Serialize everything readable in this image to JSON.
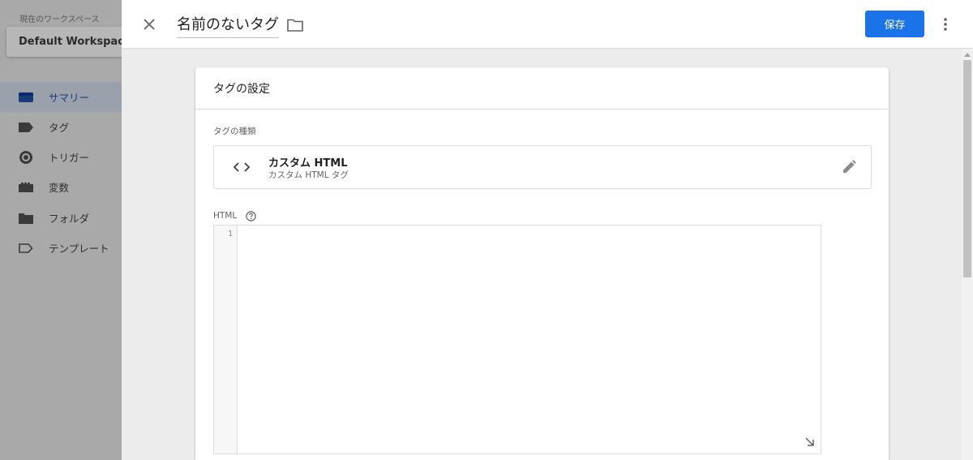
{
  "sidebar": {
    "workspace_caption": "現在のワークスペース",
    "workspace_name": "Default Workspace",
    "items": [
      {
        "label": "サマリー",
        "icon": "summary-icon",
        "active": true
      },
      {
        "label": "タグ",
        "icon": "tag-icon",
        "active": false
      },
      {
        "label": "トリガー",
        "icon": "trigger-icon",
        "active": false
      },
      {
        "label": "変数",
        "icon": "variable-icon",
        "active": false
      },
      {
        "label": "フォルダ",
        "icon": "folder-icon",
        "active": false
      },
      {
        "label": "テンプレート",
        "icon": "template-icon",
        "active": false
      }
    ]
  },
  "header": {
    "title": "名前のないタグ",
    "save_label": "保存"
  },
  "card": {
    "title": "タグの設定",
    "type_section_label": "タグの種類",
    "type_name": "カスタム HTML",
    "type_subtitle": "カスタム HTML タグ",
    "html_label": "HTML",
    "editor_line_number": "1"
  },
  "colors": {
    "accent": "#1a73e8",
    "sidebar_dim": "#a9a9a9",
    "active_nav": "#1a3a7a"
  }
}
